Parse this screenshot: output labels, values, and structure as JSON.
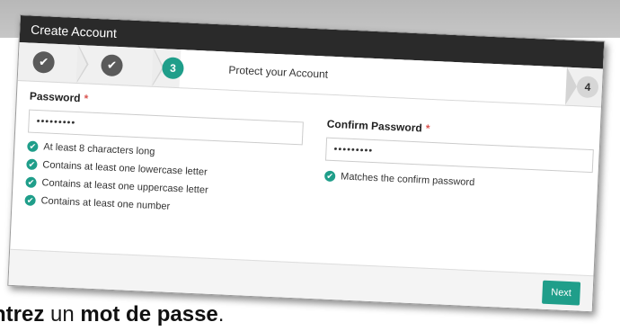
{
  "dialog": {
    "title": "Create Account"
  },
  "steps": {
    "step1_icon": "check-icon",
    "step1_glyph": "✔",
    "step2_icon": "check-icon",
    "step2_glyph": "✔",
    "active_number": "3",
    "active_label": "Protect your Account",
    "next_number": "4"
  },
  "form": {
    "password": {
      "label": "Password",
      "required_mark": "*",
      "value": "•••••••••"
    },
    "confirm": {
      "label": "Confirm Password",
      "required_mark": "*",
      "value": "•••••••••"
    },
    "password_rules": [
      "At least 8 characters long",
      "Contains at least one lowercase letter",
      "Contains at least one uppercase letter",
      "Contains at least one number"
    ],
    "confirm_rule": "Matches the confirm password",
    "check_glyph": "✔"
  },
  "footer": {
    "next_label": "Next"
  },
  "caption": {
    "part1": "ntrez",
    "part2": " un ",
    "part3": "mot de passe",
    "part4": "."
  },
  "colors": {
    "accent": "#1f9e8a",
    "titlebar": "#2a2a2a",
    "required": "#d9534f"
  }
}
